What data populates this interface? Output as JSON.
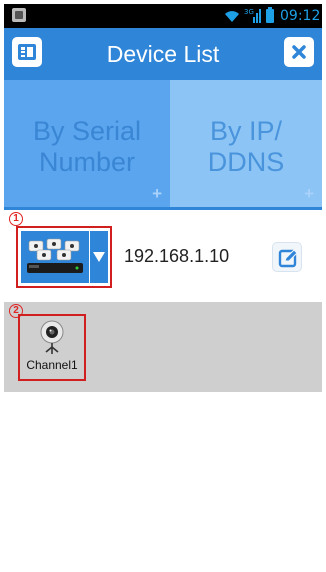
{
  "status_bar": {
    "network": "3G",
    "time": "09:12"
  },
  "header": {
    "title": "Device List",
    "menu_icon": "menu-panel-icon",
    "close_icon": "close-icon",
    "accent_color": "#2f86d8"
  },
  "tabs": [
    {
      "label": "By Serial Number",
      "add": "+"
    },
    {
      "label": "By IP/ DDNS",
      "add": "+"
    }
  ],
  "device": {
    "marker": "1",
    "address": "192.168.1.10",
    "thumbnail_icon": "nvr-cameras-icon",
    "edit_icon": "edit-icon"
  },
  "channel_panel": {
    "marker": "2",
    "channel_label": "Channel1",
    "icon": "webcam-icon"
  },
  "highlight_color": "#d11e1e"
}
